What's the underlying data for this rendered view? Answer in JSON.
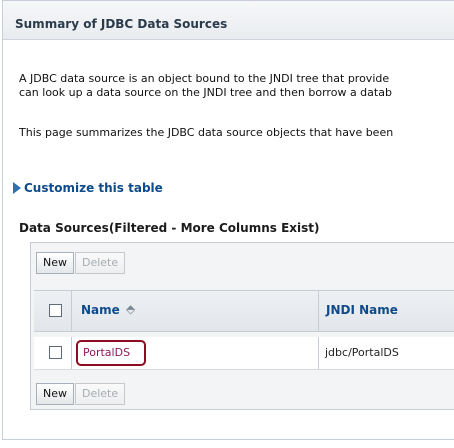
{
  "summary": {
    "title": "Summary of JDBC Data Sources"
  },
  "description": {
    "line1": "A JDBC data source is an object bound to the JNDI tree that provide",
    "line2": "can look up a data source on the JNDI tree and then borrow a datab",
    "line3": "This page summarizes the JDBC data source objects that have been"
  },
  "customize_link": "Customize this table",
  "section_title": "Data Sources(Filtered - More Columns Exist)",
  "toolbar_top": {
    "new_label": "New",
    "delete_label": "Delete"
  },
  "toolbar_bottom": {
    "new_label": "New",
    "delete_label": "Delete"
  },
  "table": {
    "headers": {
      "name": "Name",
      "jndi": "JNDI Name"
    },
    "rows": [
      {
        "name": "PortalDS",
        "jndi": "jdbc/PortalDS"
      }
    ]
  },
  "icons": {
    "customize": "expand-triangle-icon",
    "sort": "sort-ascending-icon"
  },
  "colors": {
    "link": "#0f4a8a",
    "highlight_border": "#8b0d1f",
    "visited_link": "#8a1b5b"
  }
}
